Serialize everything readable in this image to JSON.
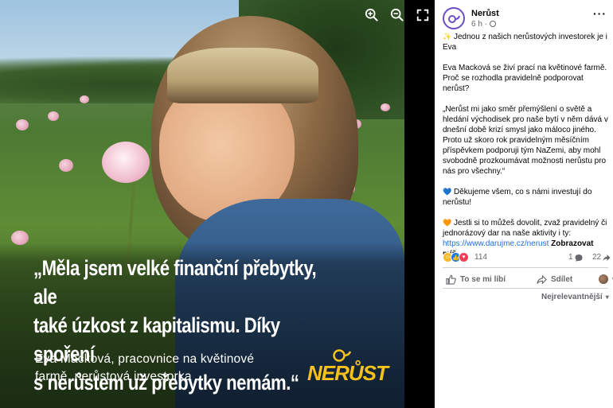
{
  "viewer": {
    "quote": "„Měla jsem velké finanční přebytky, ale\ntaké úzkost z kapitalismu. Díky spoření\ns nerůstem už přebytky nemám.“",
    "attribution": "Eva Macková, pracovnice na květinové\nfarmě, nerůstová investorka",
    "logo_text": "NERŮST",
    "toolbar": [
      "zoom-in-icon",
      "zoom-out-icon",
      "fullscreen-icon"
    ]
  },
  "post": {
    "page_name": "Nerůst",
    "time": "6 h ·",
    "more": "···",
    "paragraphs": [
      "Jednou z našich nerůstových investorek je i Eva",
      "Eva Macková se živí prací na květinové farmě. Proč se rozhodla pravidelně podporovat nerůst?",
      "„Nerůst mi jako směr přemýšlení o světě a hledání východisek pro naše bytí v něm dává v dnešní době krizí smysl jako máloco jiného. Proto už skoro rok pravidelným měsíčním příspěvkem podporuji tým NaZemi, aby mohl svobodně prozkoumávat možnosti nerůstu pro nás pro všechny.“",
      "Děkujeme všem, co s námi investují do nerůstu!",
      "Jestli si to můžeš dovolit, zvaž pravidelný či jednorázový dar na naše aktivity i ty:"
    ],
    "link": "https://www.darujme.cz/nerust",
    "see_more": "Zobrazovat míň",
    "reaction_count": "114",
    "comment_count": "1",
    "share_count": "22",
    "like_label": "To se mi líbí",
    "share_label": "Sdílet",
    "sort_label": "Nejrelevantnější"
  },
  "colors": {
    "accent": "#216fdb",
    "logo_yellow": "#f6c21a",
    "avatar_ring": "#6a4fc5"
  }
}
